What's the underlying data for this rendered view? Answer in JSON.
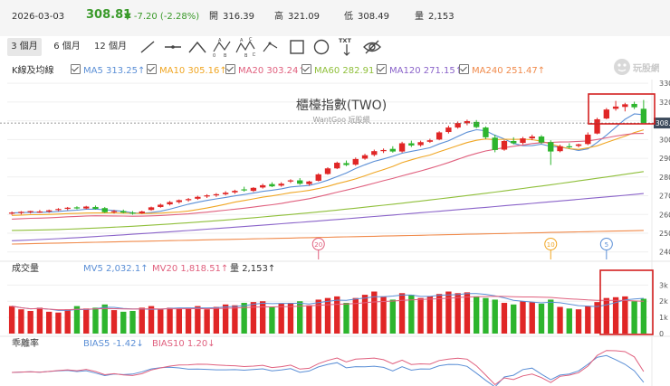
{
  "quote": {
    "date": "2026-03-03",
    "price": "308.81",
    "change": "▼ -7.20 (-2.28%)",
    "open_label": "開",
    "open": "316.39",
    "high_label": "高",
    "high": "321.09",
    "low_label": "低",
    "low": "308.49",
    "volume_label": "量",
    "volume": "2,153"
  },
  "periods": [
    "3 個月",
    "6 個月",
    "12 個月"
  ],
  "active_period": 0,
  "tools": [
    "trend-line-tool",
    "horizontal-line-tool",
    "zigzag-tool",
    "abc-pattern-tool",
    "abcd-pattern-tool",
    "rectangle-tool",
    "circle-tool",
    "text-tool",
    "hide-drawings-tool"
  ],
  "text_tool_label": "TXT",
  "main_legend": {
    "title": "K線及均線",
    "items": [
      {
        "label": "MA5",
        "value": "313.25↑",
        "color": "#5b8fd6"
      },
      {
        "label": "MA10",
        "value": "305.16↑",
        "color": "#f0a623"
      },
      {
        "label": "MA20",
        "value": "303.24↑",
        "color": "#e0607e"
      },
      {
        "label": "MA60",
        "value": "282.91↑",
        "color": "#8fbf3a"
      },
      {
        "label": "MA120",
        "value": "271.15↑",
        "color": "#8a63c9"
      },
      {
        "label": "MA240",
        "value": "251.47↑",
        "color": "#f08a4b"
      }
    ]
  },
  "watermark": {
    "title": "櫃檯指數(TWO)",
    "subtitle": "WantGoo 玩股網"
  },
  "volume_legend": {
    "title": "成交量",
    "items": [
      {
        "label": "MV5",
        "value": "2,032.1↑",
        "color": "#5b8fd6"
      },
      {
        "label": "MV20",
        "value": "1,818.51↑",
        "color": "#e0607e"
      },
      {
        "label": "量",
        "value": "2,153↑",
        "color": "#333333"
      }
    ]
  },
  "bias_legend": {
    "title": "乖離率",
    "items": [
      {
        "label": "BIAS5",
        "value": "-1.42↓",
        "color": "#5b8fd6"
      },
      {
        "label": "BIAS10",
        "value": "1.20↓",
        "color": "#e0607e"
      }
    ]
  },
  "logo_text": "玩股網",
  "colors": {
    "up": "#e02626",
    "down": "#2db52d",
    "highlight": "#d32020",
    "current_price_tag": "#3c4a5c"
  },
  "chart_data": {
    "type": "candlestick",
    "price_axis": {
      "ticks": [
        240,
        250,
        260,
        270,
        280,
        290,
        300,
        310,
        320,
        330
      ],
      "tick_labels": [
        "240",
        "250",
        "260",
        "270",
        "280",
        "290",
        "300",
        "",
        "320",
        "330"
      ]
    },
    "current_price_label": "308.81",
    "volume_axis": {
      "ticks": [
        0,
        1000,
        2000,
        3000
      ],
      "tick_labels": [
        "0",
        "1k",
        "2k",
        "3k"
      ]
    },
    "candles": [
      {
        "o": 260.6,
        "h": 261.6,
        "l": 259.8,
        "c": 261.0
      },
      {
        "o": 260.8,
        "h": 261.8,
        "l": 260.0,
        "c": 261.4
      },
      {
        "o": 261.2,
        "h": 262.0,
        "l": 260.5,
        "c": 261.8
      },
      {
        "o": 261.6,
        "h": 262.4,
        "l": 260.8,
        "c": 261.6
      },
      {
        "o": 261.6,
        "h": 262.6,
        "l": 260.9,
        "c": 262.2
      },
      {
        "o": 262.4,
        "h": 263.4,
        "l": 261.8,
        "c": 262.9
      },
      {
        "o": 263.0,
        "h": 264.0,
        "l": 262.3,
        "c": 263.6
      },
      {
        "o": 263.8,
        "h": 264.4,
        "l": 262.7,
        "c": 263.2
      },
      {
        "o": 263.2,
        "h": 264.6,
        "l": 262.8,
        "c": 264.2
      },
      {
        "o": 264.0,
        "h": 264.8,
        "l": 262.6,
        "c": 263.0
      },
      {
        "o": 263.4,
        "h": 264.0,
        "l": 260.8,
        "c": 261.2
      },
      {
        "o": 261.4,
        "h": 262.4,
        "l": 260.5,
        "c": 261.8
      },
      {
        "o": 261.8,
        "h": 262.6,
        "l": 260.6,
        "c": 261.0
      },
      {
        "o": 261.0,
        "h": 261.8,
        "l": 259.9,
        "c": 260.6
      },
      {
        "o": 260.6,
        "h": 262.0,
        "l": 260.3,
        "c": 261.6
      },
      {
        "o": 262.4,
        "h": 264.2,
        "l": 262.0,
        "c": 263.8
      },
      {
        "o": 264.0,
        "h": 265.8,
        "l": 263.6,
        "c": 265.2
      },
      {
        "o": 265.4,
        "h": 267.2,
        "l": 264.8,
        "c": 266.6
      },
      {
        "o": 266.6,
        "h": 268.0,
        "l": 265.8,
        "c": 267.6
      },
      {
        "o": 267.6,
        "h": 268.8,
        "l": 266.8,
        "c": 268.2
      },
      {
        "o": 268.4,
        "h": 270.0,
        "l": 267.8,
        "c": 269.4
      },
      {
        "o": 269.6,
        "h": 270.8,
        "l": 268.8,
        "c": 270.2
      },
      {
        "o": 270.2,
        "h": 271.4,
        "l": 269.4,
        "c": 270.8
      },
      {
        "o": 270.8,
        "h": 272.4,
        "l": 270.2,
        "c": 271.6
      },
      {
        "o": 271.8,
        "h": 273.2,
        "l": 271.0,
        "c": 272.6
      },
      {
        "o": 273.4,
        "h": 274.8,
        "l": 272.2,
        "c": 273.0
      },
      {
        "o": 272.6,
        "h": 274.6,
        "l": 272.0,
        "c": 274.2
      },
      {
        "o": 274.4,
        "h": 276.4,
        "l": 273.8,
        "c": 275.6
      },
      {
        "o": 276.2,
        "h": 277.2,
        "l": 274.6,
        "c": 275.0
      },
      {
        "o": 275.4,
        "h": 277.2,
        "l": 274.8,
        "c": 276.4
      },
      {
        "o": 277.6,
        "h": 278.8,
        "l": 276.8,
        "c": 278.2
      },
      {
        "o": 278.2,
        "h": 279.4,
        "l": 275.8,
        "c": 276.4
      },
      {
        "o": 276.2,
        "h": 278.0,
        "l": 275.4,
        "c": 277.6
      },
      {
        "o": 278.0,
        "h": 282.0,
        "l": 277.6,
        "c": 281.4
      },
      {
        "o": 281.6,
        "h": 285.2,
        "l": 281.2,
        "c": 284.6
      },
      {
        "o": 284.6,
        "h": 288.2,
        "l": 284.2,
        "c": 287.6
      },
      {
        "o": 287.4,
        "h": 288.8,
        "l": 285.8,
        "c": 286.4
      },
      {
        "o": 286.6,
        "h": 290.4,
        "l": 286.0,
        "c": 289.6
      },
      {
        "o": 289.8,
        "h": 292.4,
        "l": 289.2,
        "c": 291.6
      },
      {
        "o": 291.8,
        "h": 294.6,
        "l": 291.0,
        "c": 293.8
      },
      {
        "o": 293.8,
        "h": 295.2,
        "l": 292.8,
        "c": 294.4
      },
      {
        "o": 295.0,
        "h": 296.4,
        "l": 293.0,
        "c": 293.6
      },
      {
        "o": 293.6,
        "h": 298.8,
        "l": 293.0,
        "c": 298.0
      },
      {
        "o": 298.0,
        "h": 299.4,
        "l": 296.0,
        "c": 296.8
      },
      {
        "o": 297.0,
        "h": 299.4,
        "l": 296.2,
        "c": 298.6
      },
      {
        "o": 298.8,
        "h": 300.4,
        "l": 298.2,
        "c": 299.6
      },
      {
        "o": 300.0,
        "h": 304.4,
        "l": 299.6,
        "c": 303.8
      },
      {
        "o": 304.0,
        "h": 307.4,
        "l": 303.2,
        "c": 306.4
      },
      {
        "o": 306.4,
        "h": 309.6,
        "l": 305.8,
        "c": 308.8
      },
      {
        "o": 308.6,
        "h": 310.6,
        "l": 307.6,
        "c": 309.8
      },
      {
        "o": 309.4,
        "h": 310.4,
        "l": 306.0,
        "c": 306.6
      },
      {
        "o": 306.4,
        "h": 307.0,
        "l": 300.2,
        "c": 301.2
      },
      {
        "o": 301.0,
        "h": 302.6,
        "l": 293.2,
        "c": 294.4
      },
      {
        "o": 294.6,
        "h": 299.8,
        "l": 294.0,
        "c": 299.2
      },
      {
        "o": 299.2,
        "h": 301.2,
        "l": 297.4,
        "c": 298.0
      },
      {
        "o": 298.2,
        "h": 301.4,
        "l": 297.4,
        "c": 300.6
      },
      {
        "o": 300.6,
        "h": 302.6,
        "l": 299.6,
        "c": 301.6
      },
      {
        "o": 301.6,
        "h": 302.4,
        "l": 297.6,
        "c": 298.4
      },
      {
        "o": 298.6,
        "h": 299.6,
        "l": 286.4,
        "c": 293.6
      },
      {
        "o": 293.8,
        "h": 297.2,
        "l": 293.2,
        "c": 296.4
      },
      {
        "o": 296.4,
        "h": 298.0,
        "l": 295.2,
        "c": 296.2
      },
      {
        "o": 296.6,
        "h": 297.8,
        "l": 295.8,
        "c": 297.4
      },
      {
        "o": 297.6,
        "h": 303.8,
        "l": 297.0,
        "c": 302.6
      },
      {
        "o": 303.2,
        "h": 311.6,
        "l": 302.8,
        "c": 310.8
      },
      {
        "o": 311.2,
        "h": 316.8,
        "l": 310.8,
        "c": 316.0
      },
      {
        "o": 316.4,
        "h": 320.6,
        "l": 315.4,
        "c": 317.6
      },
      {
        "o": 317.4,
        "h": 319.6,
        "l": 315.0,
        "c": 318.8
      },
      {
        "o": 319.0,
        "h": 320.2,
        "l": 316.2,
        "c": 317.2
      },
      {
        "o": 316.4,
        "h": 321.1,
        "l": 308.5,
        "c": 308.8
      }
    ],
    "volume": [
      1700,
      1500,
      1400,
      1600,
      1350,
      1300,
      1500,
      1700,
      1550,
      1600,
      1800,
      1450,
      1350,
      1400,
      1600,
      1700,
      1500,
      1600,
      1550,
      1600,
      1700,
      1500,
      1650,
      1800,
      1750,
      1900,
      1950,
      2000,
      1650,
      1850,
      1900,
      2000,
      1750,
      2100,
      2200,
      2300,
      1900,
      2200,
      2400,
      2600,
      2300,
      2100,
      2500,
      2400,
      2200,
      2300,
      2450,
      2600,
      2500,
      2550,
      2300,
      2200,
      2100,
      1900,
      1800,
      2000,
      1950,
      1850,
      2100,
      1650,
      1550,
      1500,
      1700,
      1950,
      2200,
      2250,
      2300,
      2000,
      2153
    ],
    "ma_series": [
      {
        "name": "MA5",
        "color": "#5b8fd6",
        "start": 260.8,
        "end": 313.25
      },
      {
        "name": "MA10",
        "color": "#f0a623",
        "start": 259.5,
        "end": 305.16
      },
      {
        "name": "MA20",
        "color": "#e0607e",
        "start": 257.5,
        "end": 303.24
      },
      {
        "name": "MA60",
        "color": "#8fbf3a",
        "start": 251.5,
        "end": 282.91
      },
      {
        "name": "MA120",
        "color": "#8a63c9",
        "start": 246.0,
        "end": 271.15
      },
      {
        "name": "MA240",
        "color": "#f08a4b",
        "start": 244.2,
        "end": 251.47
      }
    ],
    "event_markers": [
      {
        "label": "20",
        "color": "#e0607e",
        "index": 33
      },
      {
        "label": "10",
        "color": "#f0a623",
        "index": 58
      },
      {
        "label": "5",
        "color": "#5b8fd6",
        "index": 64
      }
    ]
  }
}
